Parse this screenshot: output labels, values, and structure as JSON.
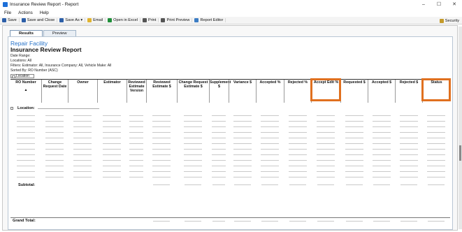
{
  "window": {
    "title": "Insurance Review Report - Report",
    "controls": [
      "–",
      "☐",
      "✕"
    ]
  },
  "menu": [
    "File",
    "Actions",
    "Help"
  ],
  "toolbar": {
    "items": [
      "Save",
      "Save and Close",
      "Save As ▾",
      "Email",
      "Open in Excel",
      "Print",
      "Print Preview",
      "Report Editor"
    ],
    "icon_colors": [
      "#2d5fa8",
      "#2d5fa8",
      "#2d5fa8",
      "#e0b330",
      "#1f8f3a",
      "#555555",
      "#555555",
      "#3c7dc4"
    ],
    "security": "Security"
  },
  "tabs": [
    "Results",
    "Preview"
  ],
  "report": {
    "company": "Repair Facility",
    "title": "Insurance Review Report",
    "meta": [
      "Date Range:",
      "Locations: All",
      "Filters: Estimator: All, Insurance Company: All, Vehicle Make: All",
      "Sorted By: RO Number (ASC)"
    ],
    "group_box": "Location",
    "columns": [
      "RO Number",
      "Change Request Date",
      "Owner",
      "Estimator",
      "Reviewed Estimate Version",
      "Reviewed Estimate $",
      "Change Request Estimate $",
      "Supplement $",
      "Variance $",
      "Accepted %",
      "Rejected %",
      "Accept Edit %",
      "Requested $",
      "Accepted $",
      "Rejected $",
      "Status"
    ],
    "sort_indicator": "▲",
    "location_label": "Location:",
    "subtotal_label": "Subtotal:",
    "grandtotal_label": "Grand Total:"
  },
  "colors": {
    "accent": "#2672c8",
    "highlight": "#e0701f"
  }
}
